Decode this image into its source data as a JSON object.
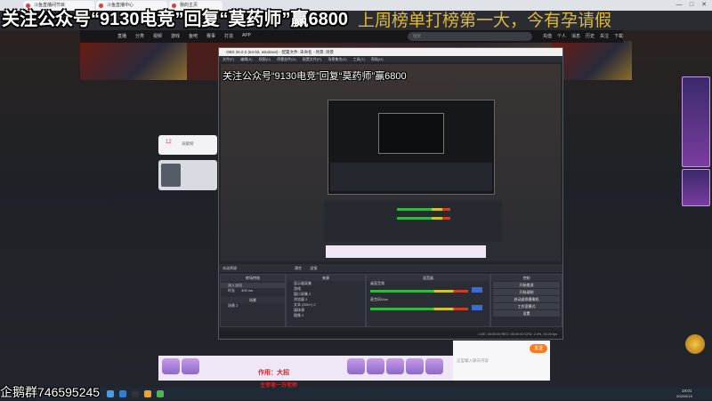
{
  "overlay": {
    "title": "关注公众号“9130电竞”回复“莫药师”赢6800",
    "marquee": "上周榜单打榜第一大，今有孕请假",
    "qq": "企鹅群746595245"
  },
  "browser": {
    "tabs": [
      {
        "label": "斗鱼直播间节目"
      },
      {
        "label": "斗鱼直播中心"
      },
      {
        "label": "我的主页"
      }
    ],
    "controls": [
      "—",
      "□",
      "✕"
    ]
  },
  "site": {
    "nav": [
      "直播",
      "分类",
      "视频",
      "游戏",
      "鱼吧",
      "赛事",
      "打造",
      "APP"
    ],
    "search_placeholder": "搜索",
    "user_links": [
      "充值",
      "个人",
      "消息",
      "历史",
      "关注",
      "下载"
    ]
  },
  "obs": {
    "title": "OBS 26.0.2 (64-bit, windows) - 配置文件: 未命名 - 场景: 场景",
    "menu": [
      "文件(F)",
      "编辑(E)",
      "视图(V)",
      "停靠部件(D)",
      "配置文件(P)",
      "场景集合(S)",
      "工具(T)",
      "帮助(H)"
    ],
    "preview_text": "关注公众号“9130电竞”回复“莫药师”赢6800",
    "scene_bar": {
      "label": "未选择源",
      "props": "属性",
      "filters": "滤镜"
    },
    "docks": {
      "scenes": {
        "title": "场景",
        "items": [
          "场景 2",
          "场景"
        ]
      },
      "sources": {
        "title": "来源",
        "items": [
          "显示器采集",
          "游戏",
          "窗口采集 2",
          "浏览器 2",
          "文本 (GDI+) 2",
          "媒体源",
          "图像 2",
          "文本 GDI+"
        ]
      },
      "mixer": {
        "title": "混音器",
        "channels": [
          {
            "name": "桌面音频",
            "db": "0.0 dB"
          },
          {
            "name": "麦克风/Aux",
            "db": "0.0 dB"
          }
        ]
      },
      "transitions": {
        "title": "转场特效",
        "fade": "淡入淡出",
        "duration_label": "时长",
        "duration": "300 ms"
      },
      "controls": {
        "title": "控制",
        "buttons": [
          "开始推流",
          "开始录制",
          "启动虚拟摄像机",
          "工作室模式",
          "设置",
          "退出"
        ]
      }
    },
    "status": "LIVE: 00:00:00  REC: 00:00:00  CPU: 2.4%, 30.00 fps"
  },
  "stream": {
    "gift_caption": "作用：大招",
    "gift_caption2": "主宰者一万老师",
    "viewers": "12",
    "rank_label": "贡献榜",
    "send_button": "发送",
    "chat_placeholder": "这里输入聊天内容"
  },
  "taskbar": {
    "time": "19:01",
    "date": "2020/9/15"
  },
  "colors": {
    "accent": "#e32020",
    "obs_bg": "#23252b",
    "overlay_text": "#ffffff",
    "marquee": "#ffd23a"
  }
}
